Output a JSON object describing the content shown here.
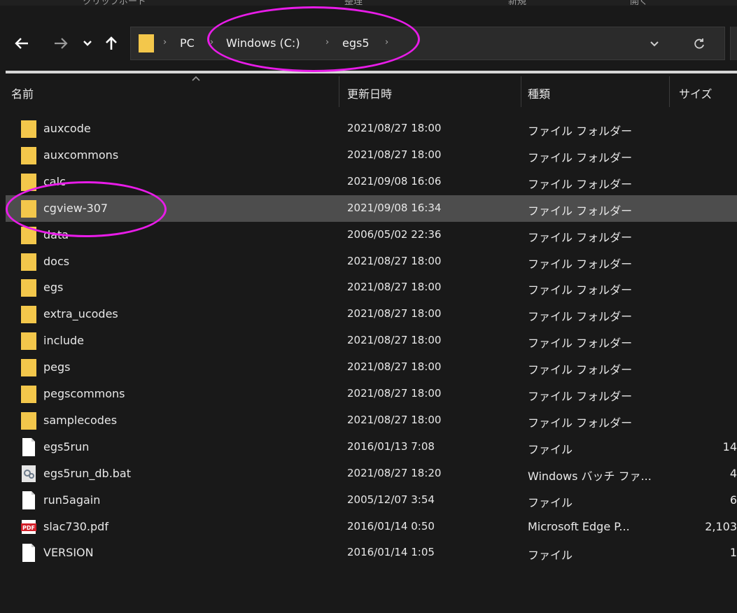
{
  "ribbon": {
    "items": [
      "クリップボード",
      "整理",
      "新規",
      "開く"
    ]
  },
  "nav": {
    "back_icon": "arrow-left-icon",
    "forward_icon": "arrow-right-icon",
    "recent_icon": "chevron-down-icon",
    "up_icon": "arrow-up-icon",
    "refresh_icon": "refresh-icon"
  },
  "breadcrumb": {
    "sep": "›",
    "items": [
      "PC",
      "Windows (C:)",
      "egs5"
    ]
  },
  "columns": {
    "name": "名前",
    "date": "更新日時",
    "type": "種類",
    "size": "サイズ"
  },
  "files": [
    {
      "name": "auxcode",
      "date": "2021/08/27 18:00",
      "type": "ファイル フォルダー",
      "size": "",
      "icon": "folder-icon"
    },
    {
      "name": "auxcommons",
      "date": "2021/08/27 18:00",
      "type": "ファイル フォルダー",
      "size": "",
      "icon": "folder-icon"
    },
    {
      "name": "calc",
      "date": "2021/09/08 16:06",
      "type": "ファイル フォルダー",
      "size": "",
      "icon": "folder-icon"
    },
    {
      "name": "cgview-307",
      "date": "2021/09/08 16:34",
      "type": "ファイル フォルダー",
      "size": "",
      "icon": "folder-icon",
      "selected": true
    },
    {
      "name": "data",
      "date": "2006/05/02 22:36",
      "type": "ファイル フォルダー",
      "size": "",
      "icon": "folder-icon"
    },
    {
      "name": "docs",
      "date": "2021/08/27 18:00",
      "type": "ファイル フォルダー",
      "size": "",
      "icon": "folder-icon"
    },
    {
      "name": "egs",
      "date": "2021/08/27 18:00",
      "type": "ファイル フォルダー",
      "size": "",
      "icon": "folder-icon"
    },
    {
      "name": "extra_ucodes",
      "date": "2021/08/27 18:00",
      "type": "ファイル フォルダー",
      "size": "",
      "icon": "folder-icon"
    },
    {
      "name": "include",
      "date": "2021/08/27 18:00",
      "type": "ファイル フォルダー",
      "size": "",
      "icon": "folder-icon"
    },
    {
      "name": "pegs",
      "date": "2021/08/27 18:00",
      "type": "ファイル フォルダー",
      "size": "",
      "icon": "folder-icon"
    },
    {
      "name": "pegscommons",
      "date": "2021/08/27 18:00",
      "type": "ファイル フォルダー",
      "size": "",
      "icon": "folder-icon"
    },
    {
      "name": "samplecodes",
      "date": "2021/08/27 18:00",
      "type": "ファイル フォルダー",
      "size": "",
      "icon": "folder-icon"
    },
    {
      "name": "egs5run",
      "date": "2016/01/13 7:08",
      "type": "ファイル",
      "size": "14",
      "icon": "file-icon"
    },
    {
      "name": "egs5run_db.bat",
      "date": "2021/08/27 18:20",
      "type": "Windows バッチ ファ...",
      "size": "4",
      "icon": "batch-file-icon"
    },
    {
      "name": "run5again",
      "date": "2005/12/07 3:54",
      "type": "ファイル",
      "size": "6",
      "icon": "file-icon"
    },
    {
      "name": "slac730.pdf",
      "date": "2016/01/14 0:50",
      "type": "Microsoft Edge P...",
      "size": "2,103",
      "icon": "pdf-icon"
    },
    {
      "name": "VERSION",
      "date": "2016/01/14 1:05",
      "type": "ファイル",
      "size": "1",
      "icon": "file-icon"
    }
  ],
  "colors": {
    "background": "#191919",
    "selected_row": "#4d4d4d",
    "folder": "#f3c74b",
    "annotation": "#e81ce8"
  }
}
